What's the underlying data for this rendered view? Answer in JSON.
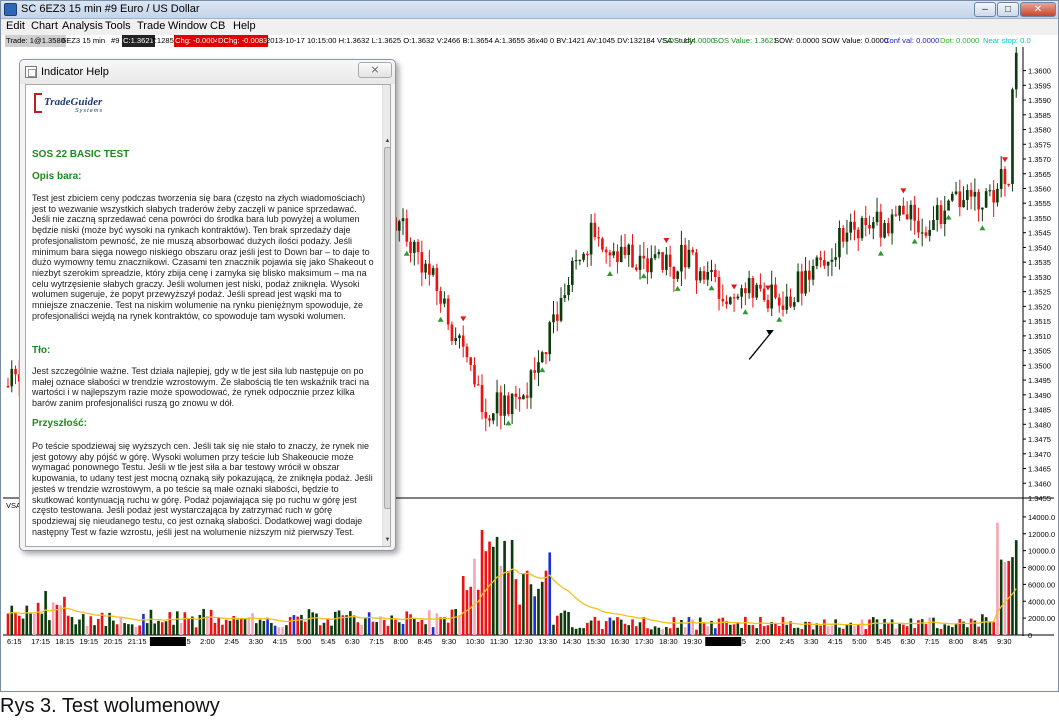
{
  "window": {
    "title": "SC 6EZ3  15 min  #9  Euro / US Dollar",
    "min_glyph": "–",
    "max_glyph": "□",
    "close_glyph": "✕"
  },
  "menu": [
    "Edit",
    "Chart",
    "Analysis",
    "Tools",
    "Trade",
    "Window",
    "CB",
    "Help"
  ],
  "infostrip": {
    "trade": "Trade: 1@1.3580",
    "symbol": "6EZ3  15 min",
    "num": "#9",
    "c": "C:1.3621",
    "t": "T:1285",
    "chg": "Chg: -0.0004",
    "dchg": "DChg: -0.0083",
    "stats": "2013-10-17 10:15:00 H:1.3632 L:1.3625 O:1.3632 V:2466 B:1.3654 A:1.3655 36x40 0 BV:1421 AV:1045 DV:132184  VSA Study:",
    "sos": "SOS: 144.0000",
    "sos_value": "SOS Value: 1.3621",
    "sow": "SOW: 0.0000  SOW Value: 0.0000",
    "conf": "Conf val: 0.0000",
    "dot": "Dot: 0.0000",
    "near": "Near stop: 0.0"
  },
  "dialog": {
    "title": "Indicator Help",
    "close_glyph": "⨯",
    "logo_text": "TradeGuider",
    "logo_sub": "Systems",
    "heading": "SOS 22 BASIC TEST",
    "sections": [
      {
        "title": "Opis bara:",
        "text": "Test jest zbiciem ceny podczas tworzenia się bara (często na złych wiadomościach) jest to wezwanie wszystkich słabych traderów żeby zaczęli w panice sprzedawać. Jeśli nie zaczną sprzedawać cena powróci do środka bara lub powyżej a wolumen będzie niski (może być wysoki na rynkach kontraktów). Ten brak sprzedaży daje profesjonalistom pewność, że nie muszą absorbować dużych ilości podaży. Jeśli minimum bara sięga nowego niskiego obszaru oraz jeśli jest to Down bar – to daje to dużo wymowny temu znacznikowi. Czasami ten znacznik pojawia się jako Shakeout o niezbyt szerokim spreadzie, który zbija cenę i zamyka się blisko maksimum – ma na celu wytrzęsienie słabych graczy. Jeśli wolumen jest niski, podaż zniknęła. Wysoki wolumen sugeruje, że popyt przewyższył podaż. Jeśli spread jest wąski ma to mniejsze znaczenie. Test na niskim wolumenie na rynku pieniężnym spowoduje, że profesjonaliści wejdą na rynek kontraktów, co spowoduje tam wysoki wolumen."
      },
      {
        "title": "Tło:",
        "text": "Jest szczególnie ważne. Test działa najlepiej, gdy w tle jest siła lub następuje on po małej oznace słabości w trendzie wzrostowym. Że słabością tle ten wskaźnik traci na wartości i w najlepszym razie może spowodować, że rynek odpocznie przez kilka barów zanim profesjonaliści ruszą go znowu w dół."
      },
      {
        "title": "Przyszłość:",
        "text": "Po teście spodziewaj się wyższych cen. Jeśli tak się nie stało to znaczy, że rynek nie jest gotowy aby pójść w górę. Wysoki wolumen przy teście lub Shakeoucie może wymagać ponownego Testu. Jeśli w tle jest siła a bar testowy wrócił w obszar kupowania, to udany test jest mocną oznaką siły pokazującą, że zniknęła podaż. Jeśli jesteś w trendzie wzrostowym, a po teście są małe oznaki słabości, będzie to skutkować kontynuacją ruchu w górę. Podaż pojawiająca się po ruchu w górę jest często testowana. Jeśli podaż jest wystarczająca by zatrzymać ruch w górę spodziewaj się nieudanego testu, co jest oznaką słabości. Dodatkowej wagi dodaje następny Test w fazie wzrostu, jeśli jest na wolumenie niższym niż pierwszy Test."
      }
    ]
  },
  "price_axis": [
    "1.3600",
    "1.3595",
    "1.3590",
    "1.3585",
    "1.3580",
    "1.3575",
    "1.3570",
    "1.3565",
    "1.3560",
    "1.3555",
    "1.3550",
    "1.3545",
    "1.3540",
    "1.3535",
    "1.3530",
    "1.3525",
    "1.3520",
    "1.3515",
    "1.3510",
    "1.3505",
    "1.3500",
    "1.3495",
    "1.3490",
    "1.3485",
    "1.3480",
    "1.3475",
    "1.3470",
    "1.3465",
    "1.3460",
    "1.3455"
  ],
  "volume_axis": [
    "14000.00",
    "12000.00",
    "10000.00",
    "8000.00",
    "6000.00",
    "4000.00",
    "2000.00",
    "0"
  ],
  "volume_label": "VSA",
  "time_axis": [
    {
      "t": "6:15"
    },
    {
      "t": "17:15"
    },
    {
      "t": "18:15"
    },
    {
      "t": "19:15"
    },
    {
      "t": "20:15"
    },
    {
      "t": "21:15"
    },
    {
      "t": "10-16 We",
      "box": true
    },
    {
      "t": "1:15"
    },
    {
      "t": "2:00"
    },
    {
      "t": "2:45"
    },
    {
      "t": "3:30"
    },
    {
      "t": "4:15"
    },
    {
      "t": "5:00"
    },
    {
      "t": "5:45"
    },
    {
      "t": "6:30"
    },
    {
      "t": "7:15"
    },
    {
      "t": "8:00"
    },
    {
      "t": "8:45"
    },
    {
      "t": "9:30"
    },
    {
      "t": "10:30"
    },
    {
      "t": "11:30"
    },
    {
      "t": "12:30"
    },
    {
      "t": "13:30"
    },
    {
      "t": "14:30"
    },
    {
      "t": "15:30"
    },
    {
      "t": "16:30"
    },
    {
      "t": "17:30"
    },
    {
      "t": "18:30"
    },
    {
      "t": "19:30"
    },
    {
      "t": "10-17 Th",
      "box": true
    },
    {
      "t": "1:15"
    },
    {
      "t": "2:00"
    },
    {
      "t": "2:45"
    },
    {
      "t": "3:30"
    },
    {
      "t": "4:15"
    },
    {
      "t": "5:00"
    },
    {
      "t": "5:45"
    },
    {
      "t": "6:30"
    },
    {
      "t": "7:15"
    },
    {
      "t": "8:00"
    },
    {
      "t": "8:45"
    },
    {
      "t": "9:30"
    }
  ],
  "colors": {
    "up_bar": "#0c3b0c",
    "down_bar": "#ee1111",
    "marker_up": "#2e9a2e",
    "marker_down": "#e01a1a",
    "vol_pink": "#f6a6b8",
    "vol_blue": "#1a2fd6",
    "vol_avg": "#f1c21b",
    "grid": "#000000"
  },
  "chart_data": {
    "type": "candlestick",
    "instrument": "Euro / US Dollar",
    "interval": "15 min",
    "price_range": [
      1.3455,
      1.3608
    ],
    "volume_range": [
      0,
      16000
    ],
    "close_path": [
      [
        0,
        1.3493
      ],
      [
        6,
        1.3505
      ],
      [
        12,
        1.3524
      ],
      [
        16,
        1.3512
      ],
      [
        20,
        1.3529
      ],
      [
        26,
        1.3527
      ],
      [
        30,
        1.353
      ],
      [
        36,
        1.3526
      ],
      [
        40,
        1.3545
      ],
      [
        48,
        1.3542
      ],
      [
        54,
        1.3541
      ],
      [
        58,
        1.353
      ],
      [
        64,
        1.3533
      ],
      [
        72,
        1.3546
      ],
      [
        80,
        1.3555
      ],
      [
        86,
        1.3566
      ],
      [
        92,
        1.3571
      ],
      [
        96,
        1.3565
      ],
      [
        100,
        1.3555
      ],
      [
        104,
        1.3547
      ],
      [
        108,
        1.354
      ],
      [
        112,
        1.3531
      ],
      [
        116,
        1.352
      ],
      [
        120,
        1.3506
      ],
      [
        124,
        1.3492
      ],
      [
        128,
        1.3484
      ],
      [
        132,
        1.3489
      ],
      [
        136,
        1.3484
      ],
      [
        140,
        1.3497
      ],
      [
        144,
        1.351
      ],
      [
        148,
        1.3525
      ],
      [
        152,
        1.3538
      ],
      [
        156,
        1.3546
      ],
      [
        160,
        1.3541
      ],
      [
        164,
        1.3537
      ],
      [
        168,
        1.3536
      ],
      [
        172,
        1.3535
      ],
      [
        176,
        1.3532
      ],
      [
        180,
        1.3538
      ],
      [
        184,
        1.3532
      ],
      [
        188,
        1.3528
      ],
      [
        192,
        1.3525
      ],
      [
        196,
        1.3525
      ],
      [
        200,
        1.3524
      ],
      [
        204,
        1.3522
      ],
      [
        206,
        1.3518
      ],
      [
        208,
        1.3523
      ],
      [
        212,
        1.3531
      ],
      [
        216,
        1.3538
      ],
      [
        220,
        1.3541
      ],
      [
        224,
        1.3545
      ],
      [
        228,
        1.3548
      ],
      [
        232,
        1.3548
      ],
      [
        236,
        1.3551
      ],
      [
        240,
        1.355
      ],
      [
        244,
        1.3548
      ],
      [
        248,
        1.355
      ],
      [
        252,
        1.3555
      ],
      [
        256,
        1.3558
      ],
      [
        260,
        1.3557
      ],
      [
        264,
        1.3562
      ],
      [
        266,
        1.3562
      ],
      [
        267,
        1.3598
      ],
      [
        268,
        1.3603
      ]
    ],
    "volume_average_shape": "smooth line, peaks near 16:30 and at last bars"
  }
}
